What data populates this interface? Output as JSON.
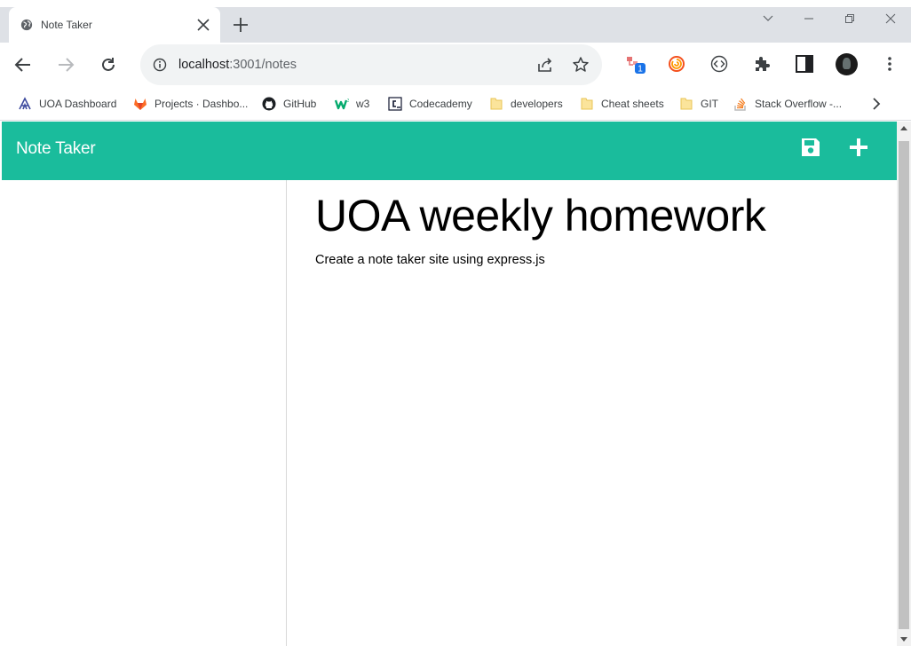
{
  "browser": {
    "tab": {
      "title": "Note Taker",
      "icon": "globe-icon"
    },
    "address": {
      "host": "localhost",
      "path": ":3001/notes"
    },
    "bookmarks": [
      {
        "label": "UOA Dashboard",
        "icon": "uoa-icon"
      },
      {
        "label": "Projects · Dashbo...",
        "icon": "gitlab-icon"
      },
      {
        "label": "GitHub",
        "icon": "github-icon"
      },
      {
        "label": "w3",
        "icon": "w3schools-icon"
      },
      {
        "label": "Codecademy",
        "icon": "codecademy-icon"
      },
      {
        "label": "developers",
        "icon": "folder-icon"
      },
      {
        "label": "Cheat sheets",
        "icon": "folder-icon"
      },
      {
        "label": "GIT",
        "icon": "folder-icon"
      },
      {
        "label": "Stack Overflow -...",
        "icon": "stackoverflow-icon"
      }
    ],
    "extension_badge": "1"
  },
  "app": {
    "title": "Note Taker",
    "accent": "#1abc9c",
    "active_note": {
      "title": "UOA weekly homework",
      "text": "Create a note taker site using express.js"
    }
  }
}
